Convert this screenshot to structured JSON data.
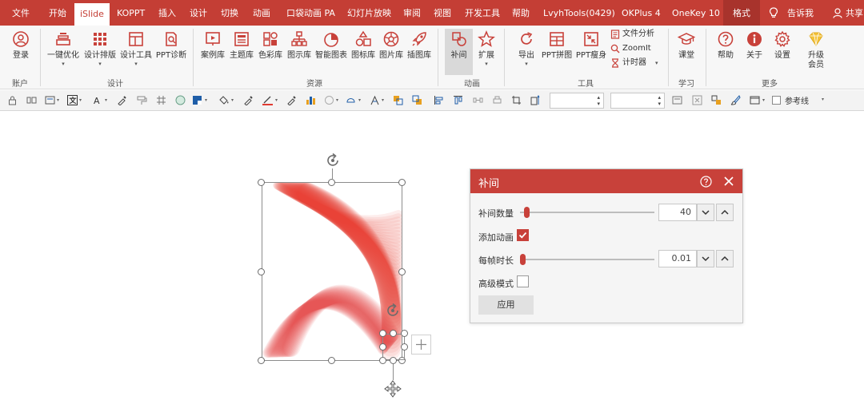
{
  "tabs": [
    "文件",
    "开始",
    "iSlide",
    "KOPPT",
    "插入",
    "设计",
    "切换",
    "动画",
    "口袋动画 PA",
    "幻灯片放映",
    "审阅",
    "视图",
    "开发工具",
    "帮助",
    "LvyhTools(0429)",
    "OKPlus 4",
    "OneKey 10",
    "格式",
    "告诉我",
    "共享"
  ],
  "ribbon": {
    "login": "登录",
    "one_click": "一键优化",
    "design_layout": "设计排版",
    "design_tools": "设计工具",
    "ppt_diag": "PPT诊断",
    "case_lib": "案例库",
    "theme_lib": "主题库",
    "color_lib": "色彩库",
    "diagram_lib": "图示库",
    "smart_chart": "智能图表",
    "icon_lib": "图标库",
    "pic_lib": "图片库",
    "illus_lib": "插图库",
    "tween": "补间",
    "extend": "扩展",
    "export": "导出",
    "ppt_puzzle": "PPT拼图",
    "ppt_slim": "PPT瘦身",
    "file_analysis": "文件分析",
    "zoomit": "ZoomIt",
    "timer": "计时器",
    "classroom": "课堂",
    "help": "帮助",
    "about": "关于",
    "settings": "设置",
    "upgrade_1": "升级",
    "upgrade_2": "会员",
    "groups": {
      "account": "账户",
      "design": "设计",
      "resources": "资源",
      "animation": "动画",
      "tools": "工具",
      "learn": "学习",
      "more": "更多"
    }
  },
  "quick_toolbar": {
    "reference_lines": "参考线"
  },
  "dialog": {
    "title": "补间",
    "tween_count_label": "补间数量",
    "tween_count_value": "40",
    "tween_count_level": 0.03,
    "add_animation_label": "添加动画",
    "add_animation_checked": true,
    "frame_duration_label": "每帧时长",
    "frame_duration_value": "0.01",
    "frame_duration_level": 0.0,
    "advanced_label": "高级模式",
    "advanced_checked": false,
    "apply_label": "应用"
  },
  "colors": {
    "accent": "#c43e35",
    "tween_red": "#e8413a"
  }
}
